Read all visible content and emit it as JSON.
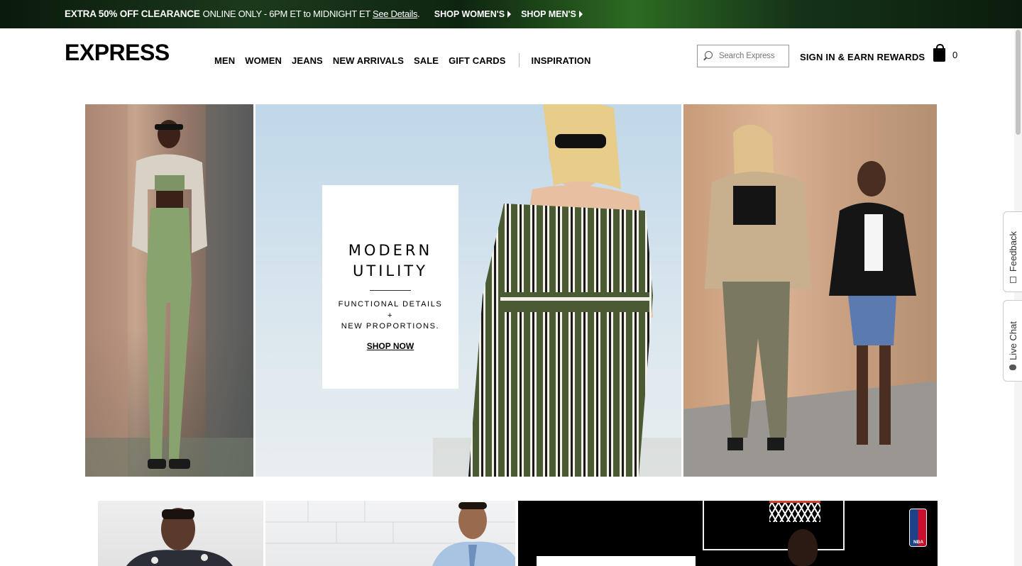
{
  "promo": {
    "headline": "EXTRA 50% OFF CLEARANCE",
    "details_text": "ONLINE ONLY - 6PM ET to MIDNIGHT ET",
    "details_link": "See Details",
    "period": ".",
    "shop_women": "SHOP WOMEN'S",
    "shop_men": "SHOP MEN'S"
  },
  "header": {
    "logo": "EXPRESS",
    "nav": [
      "MEN",
      "WOMEN",
      "JEANS",
      "NEW ARRIVALS",
      "SALE",
      "GIFT CARDS"
    ],
    "nav_extra": "INSPIRATION",
    "search_placeholder": "Search Express",
    "signin": "SIGN IN & EARN REWARDS",
    "bag_count": "0"
  },
  "hero": {
    "card": {
      "title_line1": "MODERN",
      "title_line2": "UTILITY",
      "sub_line1": "FUNCTIONAL DETAILS",
      "sub_line2": "+",
      "sub_line3": "NEW PROPORTIONS.",
      "cta": "SHOP NOW"
    }
  },
  "side_tabs": {
    "feedback": "Feedback",
    "live_chat": "Live Chat"
  },
  "tiles": {
    "nba_logo_text": "NBA"
  },
  "colors": {
    "promo_bg": "#1b3a1c",
    "accent_green": "#5f6f45",
    "nba_blue": "#1d428a",
    "nba_red": "#c8102e"
  }
}
